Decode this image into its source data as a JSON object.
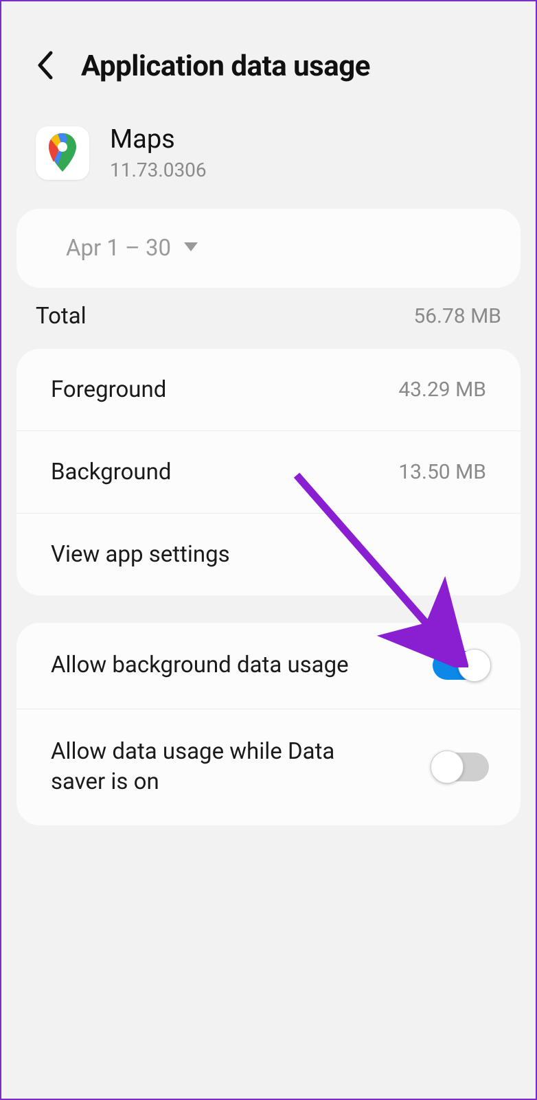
{
  "header": {
    "title": "Application data usage"
  },
  "app": {
    "name": "Maps",
    "version": "11.73.0306"
  },
  "period": {
    "label": "Apr 1 – 30"
  },
  "usage": {
    "total_label": "Total",
    "total_value": "56.78 MB",
    "foreground_label": "Foreground",
    "foreground_value": "43.29 MB",
    "background_label": "Background",
    "background_value": "13.50 MB",
    "view_settings_label": "View app settings"
  },
  "toggles": {
    "allow_bg_label": "Allow background data usage",
    "allow_bg_on": true,
    "allow_ds_label": "Allow data usage while Data saver is on",
    "allow_ds_on": false
  }
}
